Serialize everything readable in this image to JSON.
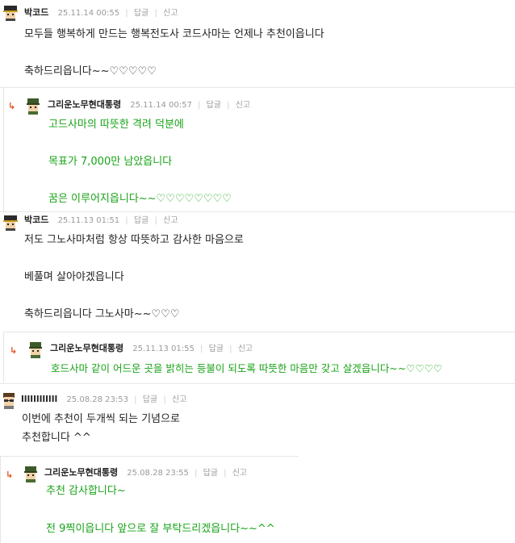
{
  "comments": [
    {
      "author": "박코드",
      "date": "25.11.14 00:55",
      "reply_label": "답글",
      "report_label": "신고",
      "avatar": "pixel-avatar-cap-icon",
      "lines": [
        "모두들 행복하게 만드는 행복전도사 코드사마는 언제나 추천이읍니다",
        "축하드리읍니다~~♡♡♡♡♡"
      ]
    },
    {
      "author": "그리운노무현대통령",
      "date": "25.11.14 00:57",
      "reply_label": "답글",
      "report_label": "신고",
      "avatar": "pixel-avatar-helmet-icon",
      "lines": [
        "고드사마의 따뜻한 격려 덕분에",
        "목표가 7,000만 남았읍니다",
        "꿈은 이루어지읍니다~~♡♡♡♡♡♡♡♡"
      ]
    },
    {
      "author": "박코드",
      "date": "25.11.13 01:51",
      "reply_label": "답글",
      "report_label": "신고",
      "avatar": "pixel-avatar-cap-icon",
      "lines": [
        "저도 그노사마처럼 항상 따뜻하고 감사한 마음으로",
        "베풀며 살아야겠읍니다",
        "축하드리읍니다 그노사마~~♡♡♡"
      ]
    },
    {
      "author": "그리운노무현대통령",
      "date": "25.11.13 01:55",
      "reply_label": "답글",
      "report_label": "신고",
      "avatar": "pixel-avatar-helmet-icon",
      "lines": [
        "호드사마 같이 어드운 곳을 밝히는 등불이 되도록 따뜻한 마음만 갖고 살겠읍니다~~♡♡♡♡"
      ]
    },
    {
      "author": "llllllllllll",
      "date": "25.08.28 23:53",
      "reply_label": "답글",
      "report_label": "신고",
      "avatar": "pixel-avatar-glasses-icon",
      "lines": [
        "이번에 추천이 두개씩 되는 기념으로",
        "추천합니다 ^^"
      ]
    },
    {
      "author": "그리운노무현대통령",
      "date": "25.08.28 23:55",
      "reply_label": "답글",
      "report_label": "신고",
      "avatar": "pixel-avatar-helmet-icon",
      "lines": [
        "추천 감사합니다~",
        "전 9찍이읍니다 앞으로 잘 부탁드리겠읍니다~~^^"
      ]
    }
  ],
  "reply_arrow_icon": "reply-arrow-icon",
  "colors": {
    "reply_text": "#17a317",
    "arrow": "#e5541f",
    "meta": "#9a9a9a",
    "border": "#e6e6e6"
  }
}
